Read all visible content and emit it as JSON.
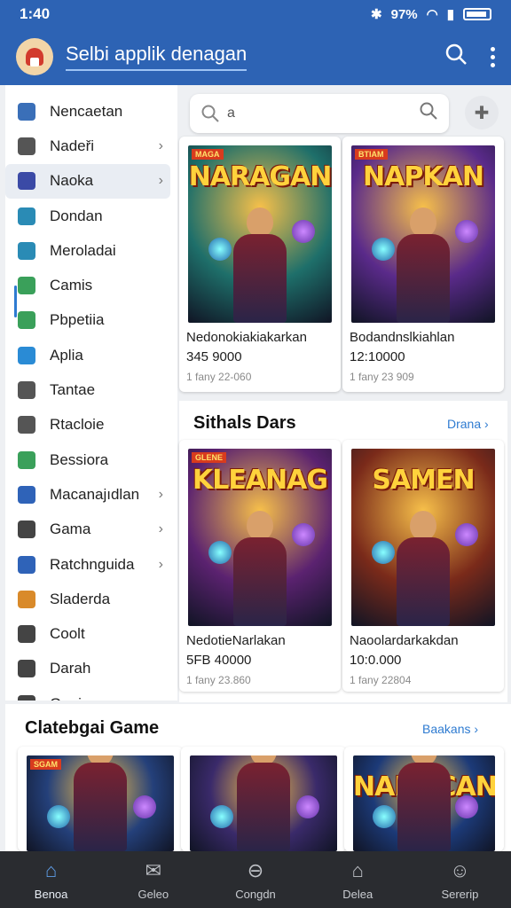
{
  "status": {
    "time": "1:40",
    "signal": "97%"
  },
  "appbar": {
    "title": "Selbi applik denagan",
    "search_icon": "search-icon",
    "menu_icon": "more-vert-icon"
  },
  "search": {
    "query": "a"
  },
  "sidebar": {
    "items": [
      {
        "label": "Nencaetan",
        "icon": "pen-icon",
        "color": "#3a6fb8",
        "chevron": false
      },
      {
        "label": "Nadeři",
        "icon": "grid-icon",
        "color": "#555555",
        "chevron": true
      },
      {
        "label": "Naoka",
        "icon": "book-icon",
        "color": "#3b4aa6",
        "chevron": true
      },
      {
        "label": "Dondan",
        "icon": "calendar-icon",
        "color": "#2a8bb5",
        "chevron": false
      },
      {
        "label": "Meroladai",
        "icon": "photo-icon",
        "color": "#2a8bb5",
        "chevron": false
      },
      {
        "label": "Camis",
        "icon": "leaf-icon",
        "color": "#3aa05a",
        "chevron": false
      },
      {
        "label": "Pbpetiia",
        "icon": "window-icon",
        "color": "#3aa05a",
        "chevron": false
      },
      {
        "label": "Aplia",
        "icon": "heart-icon",
        "color": "#2a8bd5",
        "chevron": false
      },
      {
        "label": "Tantae",
        "icon": "square-icon",
        "color": "#555555",
        "chevron": false
      },
      {
        "label": "Rtacloie",
        "icon": "frame-icon",
        "color": "#555555",
        "chevron": false
      },
      {
        "label": "Bessiora",
        "icon": "chart-icon",
        "color": "#3aa05a",
        "chevron": false
      },
      {
        "label": "Macanajıdlan",
        "icon": "compass-icon",
        "color": "#2f63b8",
        "chevron": true
      },
      {
        "label": "Gama",
        "icon": "mail-icon",
        "color": "#444444",
        "chevron": true
      },
      {
        "label": "Ratchnguida",
        "icon": "puzzle-icon",
        "color": "#2f63b8",
        "chevron": true
      },
      {
        "label": "Sladerda",
        "icon": "edit-icon",
        "color": "#d98a2a",
        "chevron": false
      },
      {
        "label": "Coolt",
        "icon": "link-icon",
        "color": "#444444",
        "chevron": false
      },
      {
        "label": "Darah",
        "icon": "plus-icon",
        "color": "#444444",
        "chevron": false
      },
      {
        "label": "Gania",
        "icon": "box-icon",
        "color": "#444444",
        "chevron": false
      }
    ]
  },
  "featured": [
    {
      "art_title": "NARAGAN",
      "badge": "MAGA",
      "name": "Nedonokiakiakarkan",
      "price": "345 9000",
      "meta": "1 fany 22-060",
      "theme": "#1e6f6a"
    },
    {
      "art_title": "NAPKAN",
      "badge": "BTIAM",
      "name": "Bodandnslkiahlan",
      "price": "12:10000",
      "meta": "1 fany 23 909",
      "theme": "#5a2a8a"
    }
  ],
  "section1": {
    "title": "Sithals Dars",
    "link": "Drana"
  },
  "section1_cards": [
    {
      "art_title": "KLEANAG",
      "badge": "GLENE",
      "name": "NedotieNarlakan",
      "price": "5FB 40000",
      "meta": "1 fany 23.860",
      "theme": "#5b2270"
    },
    {
      "art_title": "SAMEN",
      "badge": "",
      "name": "Naoolardarkakdan",
      "price": "10:0.000",
      "meta": "1 fany 22804",
      "theme": "#7a2a1a"
    }
  ],
  "section2": {
    "title": "Clatebgai Game",
    "link": "Baakans"
  },
  "section2_cards": [
    {
      "art_title": "",
      "badge": "SGAM",
      "theme": "#24407a"
    },
    {
      "art_title": "",
      "badge": "",
      "theme": "#3a2a6a"
    },
    {
      "art_title": "NANHCAN",
      "badge": "",
      "theme": "#1c3a78"
    }
  ],
  "bottomnav": [
    {
      "label": "Benoa",
      "icon": "home-icon",
      "active": true
    },
    {
      "label": "Geleo",
      "icon": "mail-icon",
      "active": false
    },
    {
      "label": "Congdn",
      "icon": "compass-icon",
      "active": false
    },
    {
      "label": "Delea",
      "icon": "store-icon",
      "active": false
    },
    {
      "label": "Sererip",
      "icon": "profile-icon",
      "active": false
    }
  ]
}
